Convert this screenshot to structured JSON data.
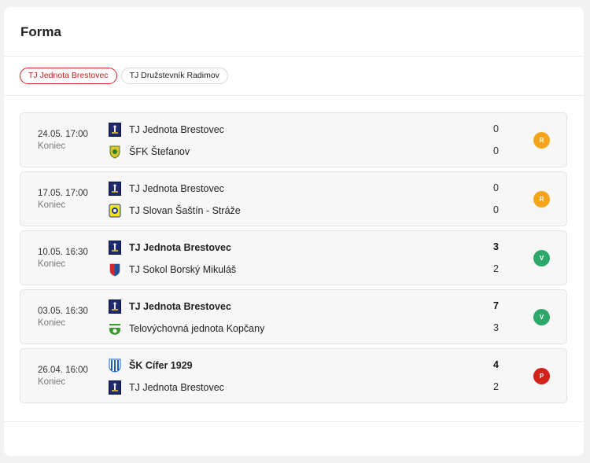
{
  "title": "Forma",
  "tabs": [
    {
      "label": "TJ Jednota Brestovec",
      "active": true
    },
    {
      "label": "TJ Družstevník Radimov",
      "active": false
    }
  ],
  "matches": [
    {
      "date": "24.05. 17:00",
      "status": "Koniec",
      "home": {
        "name": "TJ Jednota Brestovec",
        "score": "0",
        "crest": "brestovec-crest-icon"
      },
      "away": {
        "name": "ŠFK Štefanov",
        "score": "0",
        "crest": "stefanov-crest-icon"
      },
      "winner": "none",
      "result": "R"
    },
    {
      "date": "17.05. 17:00",
      "status": "Koniec",
      "home": {
        "name": "TJ Jednota Brestovec",
        "score": "0",
        "crest": "brestovec-crest-icon"
      },
      "away": {
        "name": "TJ Slovan Šaštín - Stráže",
        "score": "0",
        "crest": "sastin-crest-icon"
      },
      "winner": "none",
      "result": "R"
    },
    {
      "date": "10.05. 16:30",
      "status": "Koniec",
      "home": {
        "name": "TJ Jednota Brestovec",
        "score": "3",
        "crest": "brestovec-crest-icon"
      },
      "away": {
        "name": "TJ Sokol Borský Mikuláš",
        "score": "2",
        "crest": "borsky-mikulas-crest-icon"
      },
      "winner": "home",
      "result": "V"
    },
    {
      "date": "03.05. 16:30",
      "status": "Koniec",
      "home": {
        "name": "TJ Jednota Brestovec",
        "score": "7",
        "crest": "brestovec-crest-icon"
      },
      "away": {
        "name": "Telovýchovná jednota Kopčany",
        "score": "3",
        "crest": "kopcany-crest-icon"
      },
      "winner": "home",
      "result": "V"
    },
    {
      "date": "26.04. 16:00",
      "status": "Koniec",
      "home": {
        "name": "ŠK Cífer 1929",
        "score": "4",
        "crest": "cifer-crest-icon"
      },
      "away": {
        "name": "TJ Jednota Brestovec",
        "score": "2",
        "crest": "brestovec-crest-icon"
      },
      "winner": "home",
      "result": "P"
    }
  ],
  "colors": {
    "accent": "#d7261e",
    "draw": "#f5a51a",
    "win": "#2ea86a",
    "loss": "#d2221c"
  }
}
